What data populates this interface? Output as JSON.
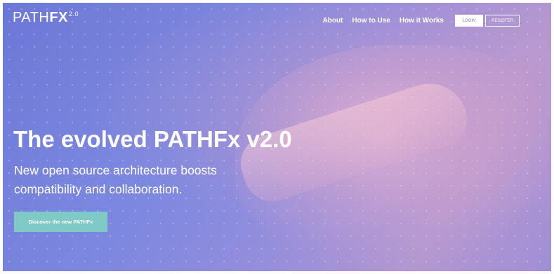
{
  "brand": {
    "text": "PATH",
    "bold": "FX",
    "version": "2.0"
  },
  "nav": {
    "items": [
      {
        "label": "About"
      },
      {
        "label": "How to Use"
      },
      {
        "label": "How it Works"
      }
    ],
    "login_label": "LOGIN",
    "register_label": "REGISTER"
  },
  "hero": {
    "headline": "The evolved PATHFx v2.0",
    "subheadline": "New open source architecture boosts compatibility and collaboration.",
    "cta_label": "Discover the new PATHFx"
  },
  "colors": {
    "accent_button": "#7fc9c7",
    "hero_primary": "#7e86dd",
    "hero_secondary": "#b497cf"
  }
}
